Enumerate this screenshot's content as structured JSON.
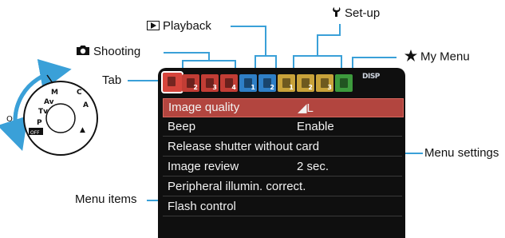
{
  "labels": {
    "playback": "Playback",
    "setup": "Set-up",
    "shooting": "Shooting",
    "my_menu": "My Menu",
    "tab": "Tab",
    "menu_items": "Menu items",
    "menu_settings": "Menu settings"
  },
  "tabs": [
    {
      "color": "#d6453c",
      "number": ""
    },
    {
      "color": "#c23d35",
      "number": "2"
    },
    {
      "color": "#c23d35",
      "number": "3"
    },
    {
      "color": "#c23d35",
      "number": "4"
    },
    {
      "color": "#2f7fc6",
      "number": "1"
    },
    {
      "color": "#2f7fc6",
      "number": "2"
    },
    {
      "color": "#c8a23a",
      "number": "1"
    },
    {
      "color": "#c8a23a",
      "number": "2"
    },
    {
      "color": "#c8a23a",
      "number": "3"
    },
    {
      "color": "#3d9a3d",
      "number": ""
    }
  ],
  "disp_label": "DISP",
  "menu": [
    {
      "name": "Image quality",
      "value": "◢L"
    },
    {
      "name": "Beep",
      "value": "Enable"
    },
    {
      "name": "Release shutter without card",
      "value": ""
    },
    {
      "name": "Image review",
      "value": "2 sec."
    },
    {
      "name": "Peripheral illumin. correct.",
      "value": ""
    },
    {
      "name": "Flash control",
      "value": ""
    }
  ],
  "colors": {
    "callout": "#3aa0d8",
    "selected_row": "#b2453f"
  },
  "icons": [
    "playback-icon",
    "wrench-icon",
    "camera-icon",
    "star-icon",
    "mode-dial-icon"
  ]
}
